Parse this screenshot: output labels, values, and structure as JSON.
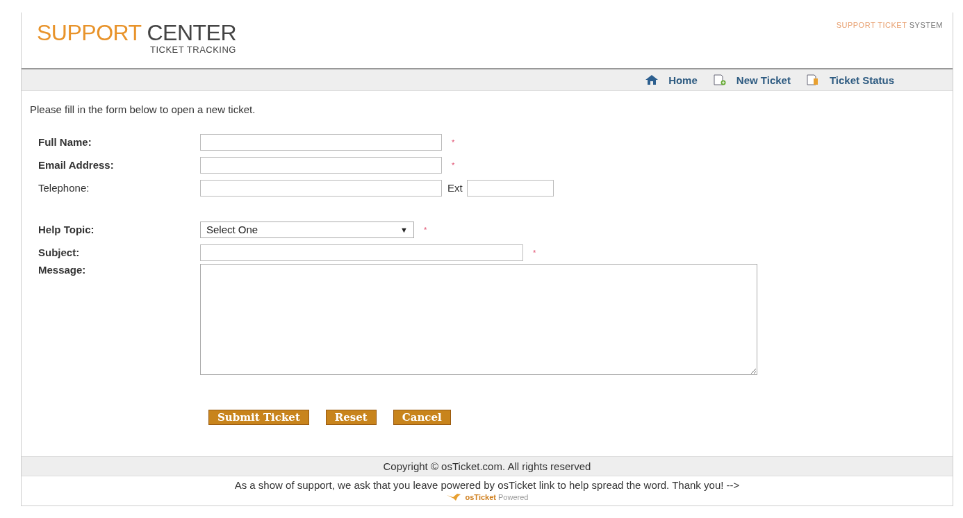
{
  "header": {
    "logo_word_1": "SUPPORT",
    "logo_word_2": "CENTER",
    "logo_subtitle": "TICKET TRACKING",
    "tagline_1": "SUPPORT TICKET",
    "tagline_2": "SYSTEM"
  },
  "nav": [
    {
      "label": "Home"
    },
    {
      "label": "New Ticket"
    },
    {
      "label": "Ticket Status"
    }
  ],
  "intro": "Please fill in the form below to open a new ticket.",
  "fields": [
    {
      "kind": "text",
      "label": "Full Name:",
      "bold": true,
      "required_mark": "*"
    },
    {
      "kind": "text",
      "label": "Email Address:",
      "bold": true,
      "required_mark": "*"
    },
    {
      "kind": "phone",
      "label": "Telephone:",
      "bold": false,
      "ext_label": "Ext"
    },
    {
      "kind": "select",
      "label": "Help Topic:",
      "bold": true,
      "value": "Select One",
      "arrow": "▼",
      "required_mark": "*"
    },
    {
      "kind": "wide_text",
      "label": "Subject:",
      "bold": true,
      "required_mark": "*"
    },
    {
      "kind": "textarea",
      "label": "Message:",
      "bold": true
    }
  ],
  "buttons": [
    "Submit Ticket",
    "Reset",
    "Cancel"
  ],
  "footer": {
    "copyright": "Copyright © osTicket.com. All rights reserved",
    "notice": "As a show of support, we ask that you leave powered by osTicket link to help spread the word. Thank you! -->",
    "badge_name": "osTicket",
    "badge_suffix": "Powered"
  }
}
